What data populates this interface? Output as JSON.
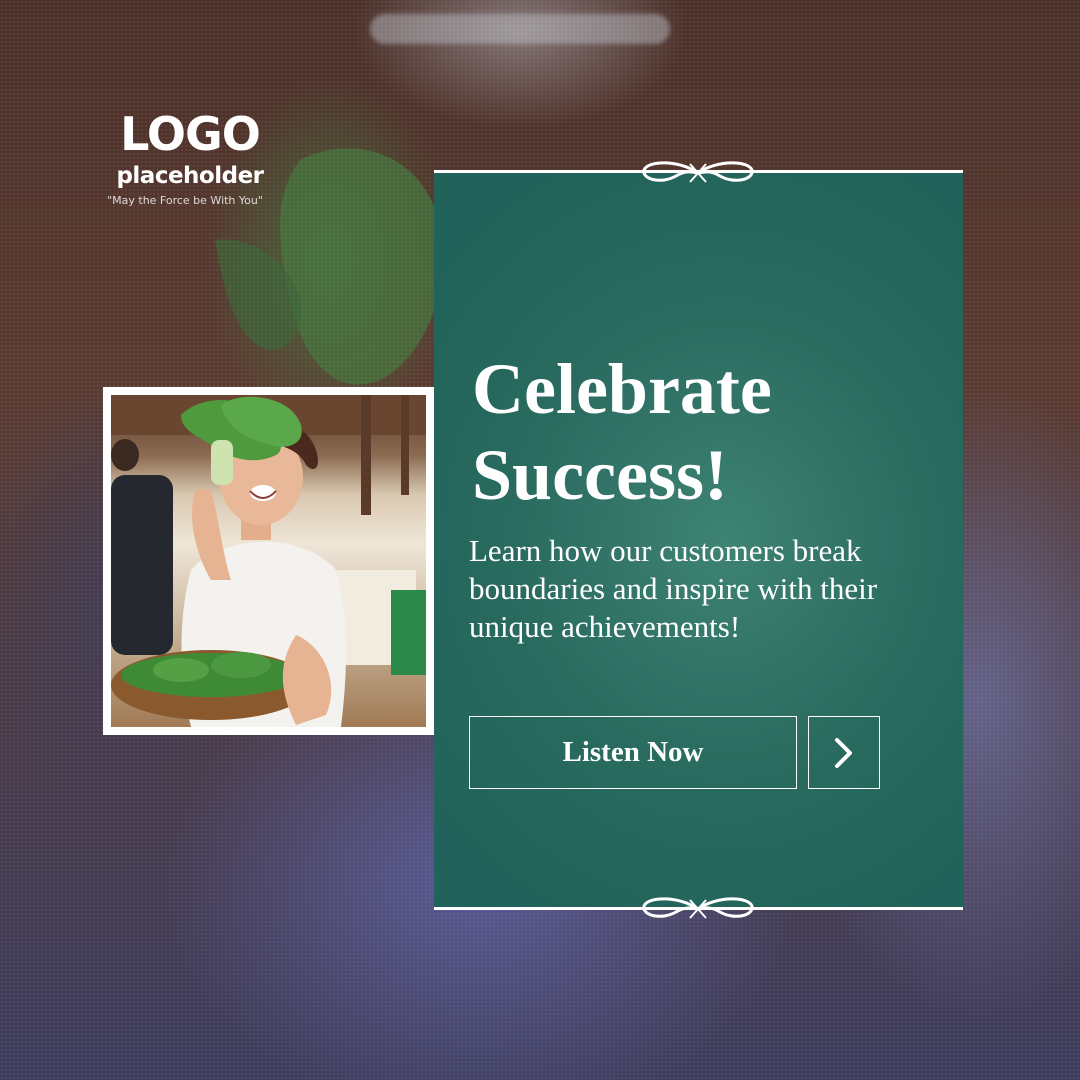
{
  "logo": {
    "main": "LOGO",
    "sub": "placeholder",
    "tagline": "\"May the Force be With You\""
  },
  "card": {
    "headline_line1": "Celebrate",
    "headline_line2": "Success!",
    "body": "Learn how our customers break boundaries and inspire with their unique achievements!",
    "cta_label": "Listen Now",
    "arrow_icon": "chevron-right-icon",
    "background_color": "#2a6b5f"
  },
  "photo": {
    "subject": "woman-holding-bok-choy-icon"
  }
}
